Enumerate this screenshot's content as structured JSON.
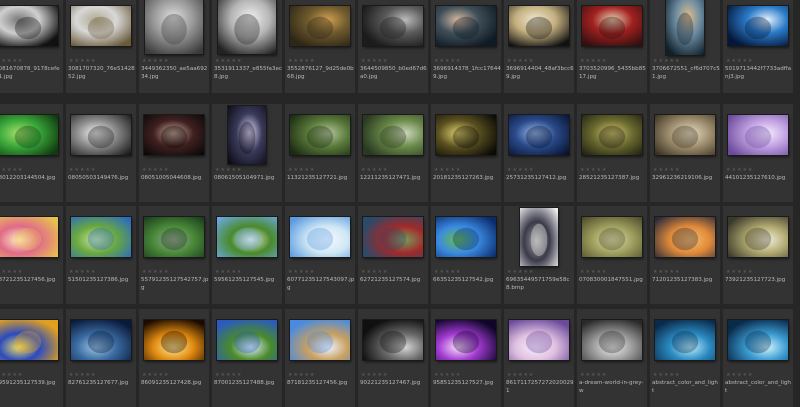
{
  "rating_glyphs": "★★★★★",
  "colors": {
    "background": "#262626",
    "cell": "#333333",
    "filename_text": "#b9b9b9",
    "stars": "#555555"
  },
  "rows": [
    [
      {
        "filename": "3081670878_9178cefe31.jpg",
        "orientation": "landscape",
        "palette": [
          "#111111",
          "#cfcfcf",
          "#777777"
        ]
      },
      {
        "filename": "3081707320_76e5142852.jpg",
        "orientation": "landscape",
        "palette": [
          "#6a5a3a",
          "#d8d8d8",
          "#b0a890"
        ]
      },
      {
        "filename": "3449362350_ae5aa69234.jpg",
        "orientation": "square",
        "palette": [
          "#3a3a3a",
          "#9a9a9a",
          "#e0e0e0"
        ]
      },
      {
        "filename": "3531911337_e855fa3ec8.jpg",
        "orientation": "square",
        "palette": [
          "#222222",
          "#b5b5b5",
          "#f0f0f0"
        ]
      },
      {
        "filename": "3552876127_9d25de0b68.jpg",
        "orientation": "landscape",
        "palette": [
          "#2e2616",
          "#6e5a2e",
          "#cfa050"
        ]
      },
      {
        "filename": "3644509850_b0ed67d6a0.jpg",
        "orientation": "landscape",
        "palette": [
          "#1c1c1c",
          "#5a5a5a",
          "#bcbcbc"
        ]
      },
      {
        "filename": "3696914378_1fcc176449.jpg",
        "orientation": "landscape",
        "palette": [
          "#0f1a22",
          "#3f4f5a",
          "#d8b8a0"
        ]
      },
      {
        "filename": "3696914404_48af3bcc69.jpg",
        "orientation": "landscape",
        "palette": [
          "#101010",
          "#c4b080",
          "#f0e8d0"
        ]
      },
      {
        "filename": "3703520996_5435bb8517.jpg",
        "orientation": "landscape",
        "palette": [
          "#301010",
          "#a02020",
          "#e8d0b0"
        ]
      },
      {
        "filename": "3706672551_cf6d707c51.jpg",
        "orientation": "portrait",
        "palette": [
          "#10202a",
          "#6a8aa0",
          "#e0c090"
        ]
      },
      {
        "filename": "5019713442f7733adffanj3.jpg",
        "orientation": "landscape",
        "palette": [
          "#06183a",
          "#2a7ac8",
          "#e8f4ff"
        ]
      }
    ],
    [
      {
        "filename": "08012203144504.jpg",
        "orientation": "landscape",
        "palette": [
          "#103a10",
          "#3aa83a",
          "#a8e06a"
        ]
      },
      {
        "filename": "08050503149476.jpg",
        "orientation": "landscape",
        "palette": [
          "#1a1a1a",
          "#8a8a8a",
          "#f4f4f4"
        ]
      },
      {
        "filename": "08051005044608.jpg",
        "orientation": "landscape",
        "palette": [
          "#050505",
          "#402020",
          "#d0b0a0"
        ]
      },
      {
        "filename": "08061505104971.jpg",
        "orientation": "portrait",
        "palette": [
          "#0a0a14",
          "#3a3a5a",
          "#e8e0ff"
        ]
      },
      {
        "filename": "11321235127721.jpg",
        "orientation": "landscape",
        "palette": [
          "#1a2a12",
          "#5a7a3a",
          "#b8c8a0"
        ]
      },
      {
        "filename": "12211235127471.jpg",
        "orientation": "landscape",
        "palette": [
          "#2a3a20",
          "#6a8a4a",
          "#d0d8c0"
        ]
      },
      {
        "filename": "20181235127263.jpg",
        "orientation": "landscape",
        "palette": [
          "#0a0a06",
          "#5a5020",
          "#e0d070"
        ]
      },
      {
        "filename": "25731235127412.jpg",
        "orientation": "landscape",
        "palette": [
          "#06102a",
          "#2a4a8a",
          "#a0c0f0"
        ]
      },
      {
        "filename": "28521235127387.jpg",
        "orientation": "landscape",
        "palette": [
          "#1a1a10",
          "#6a6a30",
          "#d8c870"
        ]
      },
      {
        "filename": "32961236219106.jpg",
        "orientation": "landscape",
        "palette": [
          "#3a3020",
          "#a09070",
          "#e8e0c8"
        ]
      },
      {
        "filename": "44101235127610.jpg",
        "orientation": "landscape",
        "palette": [
          "#6a4a9a",
          "#c0a0e0",
          "#f4ecff"
        ]
      }
    ],
    [
      {
        "filename": "48721235127456.jpg",
        "orientation": "landscape",
        "palette": [
          "#e8c050",
          "#e06a8a",
          "#fff0c0"
        ]
      },
      {
        "filename": "51501235127386.jpg",
        "orientation": "landscape",
        "palette": [
          "#2a6ac0",
          "#6aa840",
          "#d0e8a0"
        ]
      },
      {
        "filename": "55791235127542757.jpg",
        "orientation": "landscape",
        "palette": [
          "#1a3a1a",
          "#4a8a3a",
          "#a0a8a0"
        ]
      },
      {
        "filename": "59561235127545.jpg",
        "orientation": "landscape",
        "palette": [
          "#6aa8e0",
          "#4a8a2a",
          "#f0f0f0"
        ]
      },
      {
        "filename": "60771235127543097.jpg",
        "orientation": "landscape",
        "palette": [
          "#5a9ae0",
          "#d0e8f4",
          "#f8f8ff"
        ]
      },
      {
        "filename": "62721235127574.jpg",
        "orientation": "landscape",
        "palette": [
          "#2a4a6a",
          "#a02a2a",
          "#7a9a5a"
        ]
      },
      {
        "filename": "66351235127542.jpg",
        "orientation": "landscape",
        "palette": [
          "#0a2a6a",
          "#3a8ae0",
          "#6ac04a"
        ]
      },
      {
        "filename": "69635449571759e58c8.bmp",
        "orientation": "portrait",
        "palette": [
          "#f0f0f0",
          "#3a3a4a",
          "#a0a0a0"
        ]
      },
      {
        "filename": "070830001847551.jpg",
        "orientation": "landscape",
        "palette": [
          "#4a4a2a",
          "#a0a060",
          "#e0e0b0"
        ]
      },
      {
        "filename": "71201235127383.jpg",
        "orientation": "landscape",
        "palette": [
          "#2a2a3a",
          "#e08a3a",
          "#f8c070"
        ]
      },
      {
        "filename": "73921235127723.jpg",
        "orientation": "landscape",
        "palette": [
          "#3a3a2a",
          "#b0a870",
          "#f4f0d8"
        ]
      }
    ],
    [
      {
        "filename": "79591235127539.jpg",
        "orientation": "landscape",
        "palette": [
          "#e0a020",
          "#2a4ac0",
          "#f0e060"
        ]
      },
      {
        "filename": "82761235127677.jpg",
        "orientation": "landscape",
        "palette": [
          "#0a1a3a",
          "#3a6aa0",
          "#a0c8e8"
        ]
      },
      {
        "filename": "86091235127428.jpg",
        "orientation": "landscape",
        "palette": [
          "#1a0a00",
          "#e08a10",
          "#fff0a0"
        ]
      },
      {
        "filename": "87001235127488.jpg",
        "orientation": "landscape",
        "palette": [
          "#2a5ac0",
          "#4a8a2a",
          "#e0f0ff"
        ]
      },
      {
        "filename": "87181235127456.jpg",
        "orientation": "landscape",
        "palette": [
          "#4a8ae0",
          "#c8a060",
          "#f0f4ff"
        ]
      },
      {
        "filename": "90221235127467.jpg",
        "orientation": "landscape",
        "palette": [
          "#101010",
          "#6a6a6a",
          "#d8d8d8"
        ]
      },
      {
        "filename": "95851235127527.jpg",
        "orientation": "landscape",
        "palette": [
          "#10062a",
          "#a03ad0",
          "#ffe0ff"
        ]
      },
      {
        "filename": "86171172572720200291",
        "orientation": "landscape",
        "palette": [
          "#6a4a9a",
          "#e0c0e0",
          "#f8f0ff"
        ]
      },
      {
        "filename": "a-dream-world-in-grey-w",
        "orientation": "landscape",
        "palette": [
          "#2a2a2a",
          "#9a9a9a",
          "#f0f0f0"
        ]
      },
      {
        "filename": "abstract_color_and_light",
        "orientation": "landscape",
        "palette": [
          "#0a2a4a",
          "#2a8ac0",
          "#c0f0ff"
        ]
      },
      {
        "filename": "abstract_color_and_light",
        "orientation": "landscape",
        "palette": [
          "#0a2a4a",
          "#3a9ad0",
          "#d0f4ff"
        ]
      }
    ]
  ]
}
